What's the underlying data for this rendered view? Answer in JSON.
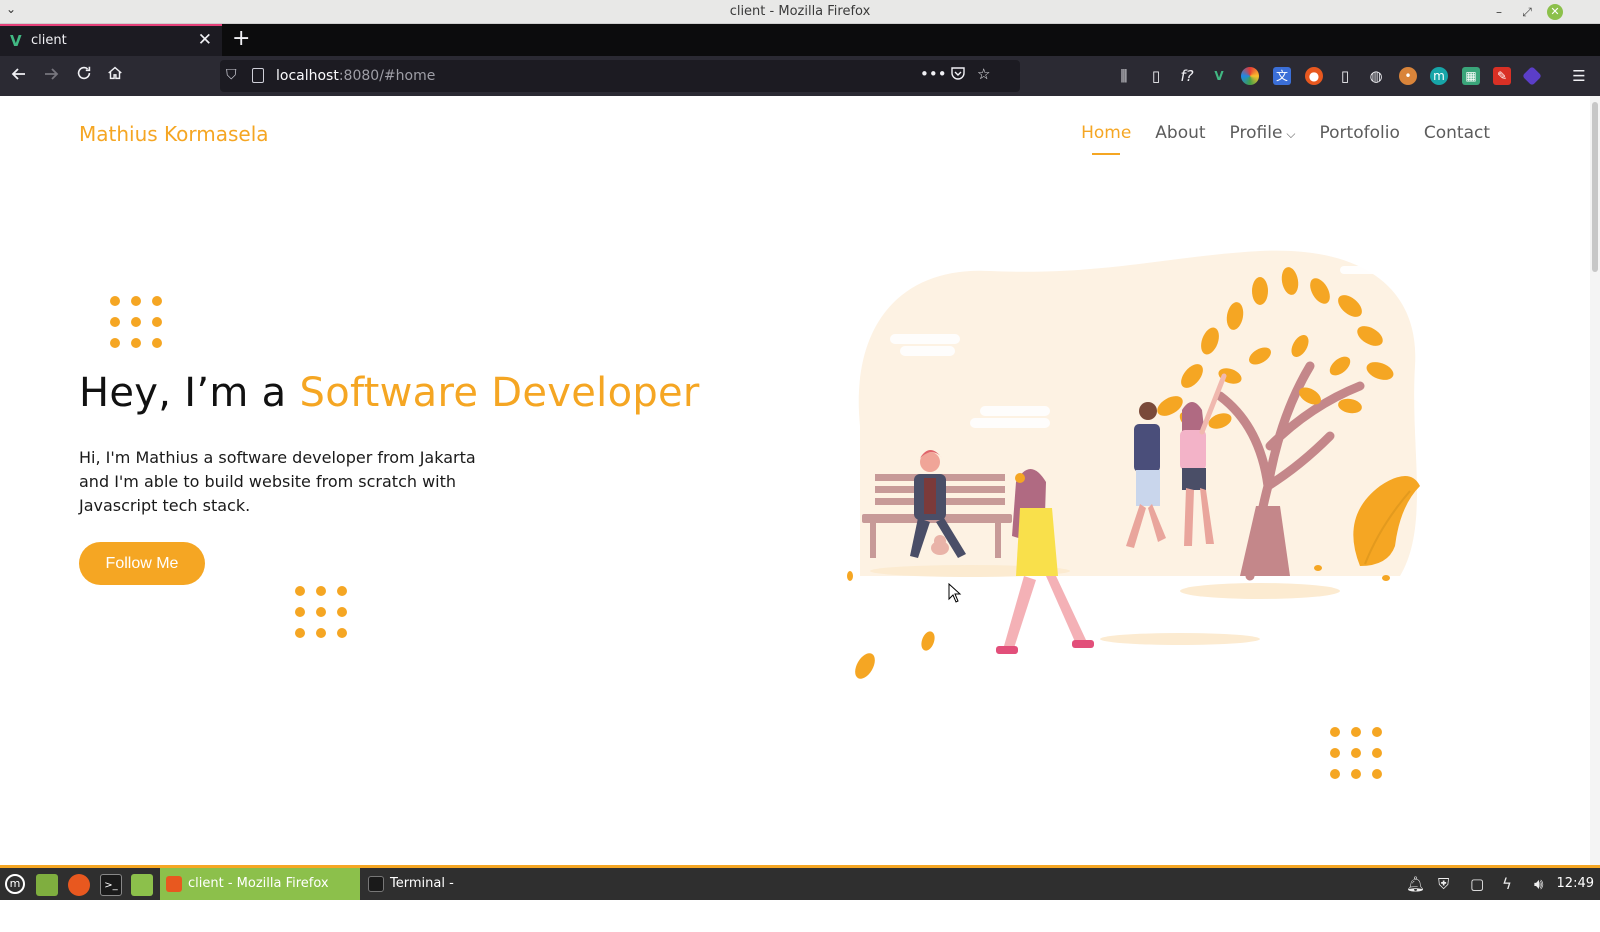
{
  "window": {
    "title": "client - Mozilla Firefox",
    "menu_icon": "chevron-down-icon"
  },
  "tabs": [
    {
      "label": "client",
      "favicon": "vue-logo-icon"
    }
  ],
  "urlbar": {
    "host": "localhost",
    "rest": ":8080/#home"
  },
  "site": {
    "brand": "Mathius Kormasela",
    "nav": {
      "home": "Home",
      "about": "About",
      "profile": "Profile",
      "portfolio": "Portofolio",
      "contact": "Contact"
    },
    "hero": {
      "title_prefix": "Hey, I’m a ",
      "title_accent": "Software Developer",
      "description": "Hi, I'm Mathius a software developer from Jakarta and I'm able to build website from scratch with Javascript tech stack.",
      "button": "Follow Me"
    },
    "accent_color": "#f5a623"
  },
  "taskbar": {
    "tasks": [
      {
        "label": "client - Mozilla Firefox",
        "active": true
      },
      {
        "label": "Terminal - mathius@mathi...",
        "active": false
      }
    ],
    "clock": "12:49"
  }
}
